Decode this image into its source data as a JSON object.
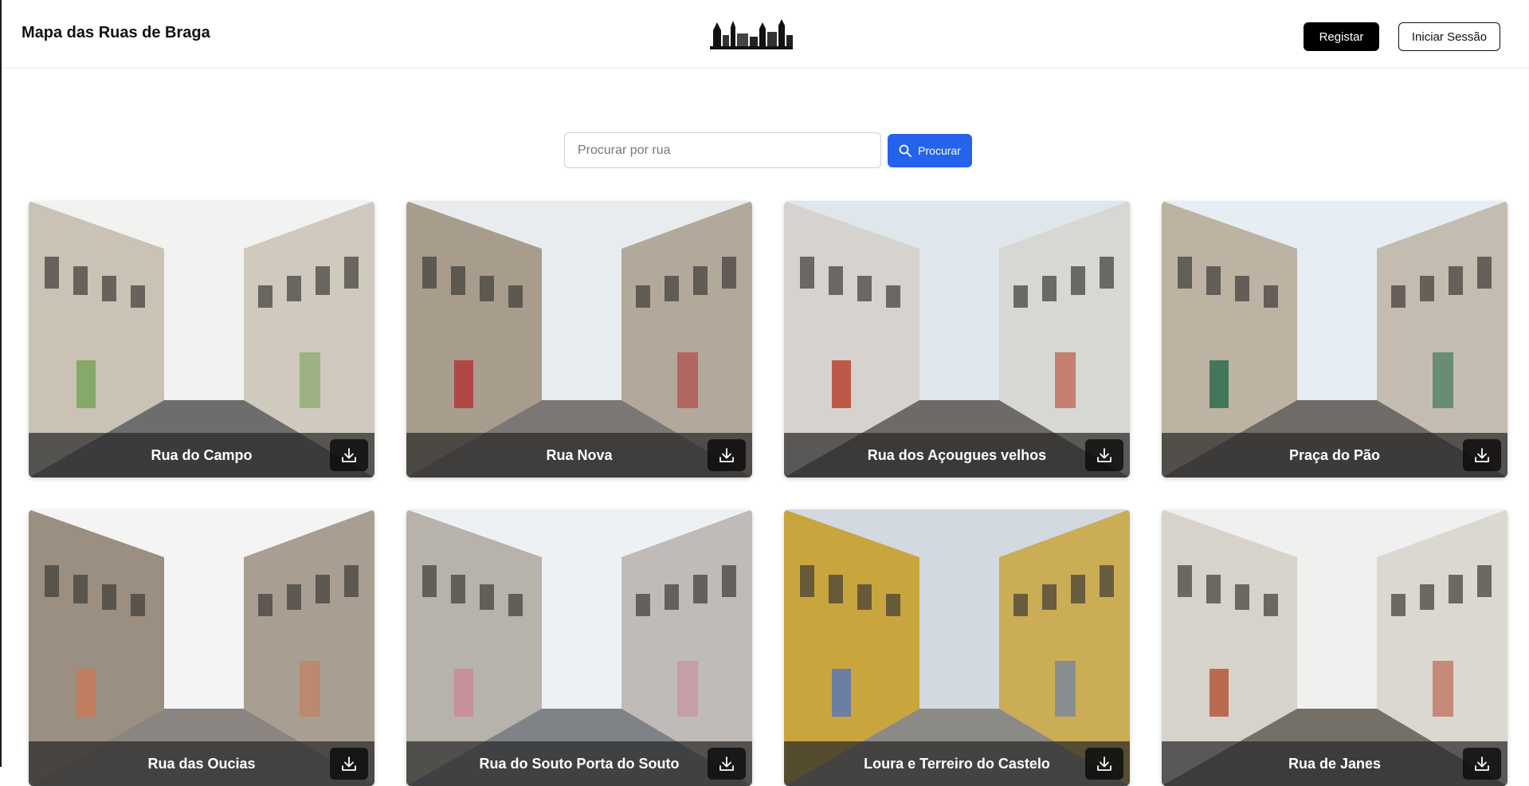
{
  "header": {
    "brand": "Mapa das Ruas de Braga",
    "logo_icon": "braga-skyline-logo-icon",
    "register_label": "Registar",
    "login_label": "Iniciar Sessão"
  },
  "search": {
    "placeholder": "Procurar por rua",
    "value": "",
    "button_label": "Procurar",
    "button_icon": "search-icon",
    "button_color": "#2563eb"
  },
  "streets": [
    {
      "name": "Rua do Campo",
      "sky": "#f2f2f0",
      "wall": "#c9c2b5",
      "ground": "#6d6d6d",
      "accent": "#7aa35a"
    },
    {
      "name": "Rua Nova",
      "sky": "#e8ecef",
      "wall": "#a89d8c",
      "ground": "#7b7775",
      "accent": "#b33a3a"
    },
    {
      "name": "Rua dos Açougues velhos",
      "sky": "#dfe6ec",
      "wall": "#d6d3cf",
      "ground": "#6e6a66",
      "accent": "#b8442f"
    },
    {
      "name": "Praça do Pão",
      "sky": "#e6edf3",
      "wall": "#bdb3a3",
      "ground": "#6f6b66",
      "accent": "#2e6b4f"
    },
    {
      "name": "Rua das Oucias",
      "sky": "#f4f4f4",
      "wall": "#9a8f80",
      "ground": "#8a8580",
      "accent": "#c97a5a"
    },
    {
      "name": "Rua do Souto Porta do Souto",
      "sky": "#eef1f4",
      "wall": "#b7b2aa",
      "ground": "#7f8287",
      "accent": "#c98a9a"
    },
    {
      "name": "Loura e Terreiro do Castelo",
      "sky": "#d3d9e0",
      "wall": "#c9a53d",
      "ground": "#8c8a86",
      "accent": "#5b78b5"
    },
    {
      "name": "Rua de Janes",
      "sky": "#f0f0ee",
      "wall": "#d7d3cb",
      "ground": "#747068",
      "accent": "#b5573b"
    }
  ],
  "card_action_icon": "download-icon"
}
